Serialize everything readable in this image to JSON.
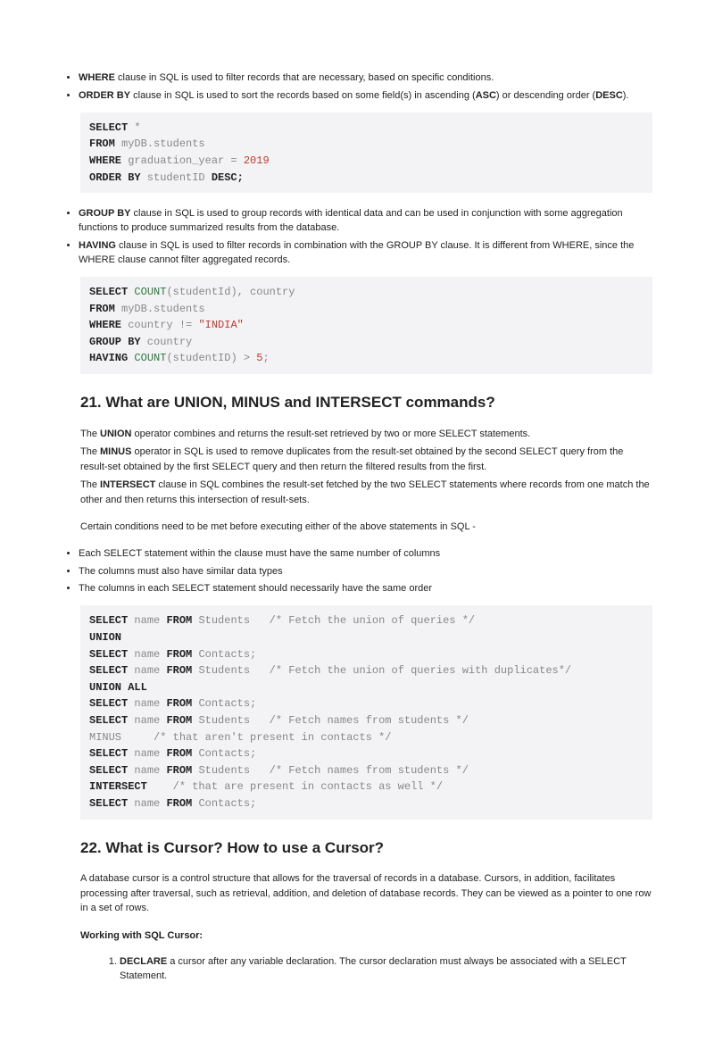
{
  "bullets1": {
    "where_kw": "WHERE",
    "where_txt": " clause in SQL is used to filter records that are necessary, based on specific conditions.",
    "orderby_kw": "ORDER BY",
    "orderby_txt1": " clause in SQL is used to sort the records based on some field(s) in ascending (",
    "orderby_asc": "ASC",
    "orderby_txt2": ") or descending order (",
    "orderby_desc": "DESC",
    "orderby_txt3": ")."
  },
  "code1": {
    "select": "SELECT",
    "star": " *",
    "from": "FROM",
    "tbl": " myDB.students",
    "where": "WHERE",
    "gy": " graduation_year = ",
    "yr": "2019",
    "orderby": "ORDER BY",
    "sid": " studentID ",
    "desc": "DESC;"
  },
  "bullets2": {
    "groupby_kw": "GROUP BY",
    "groupby_txt": " clause in SQL is used to group records with identical data and can be used in conjunction with some aggregation functions to produce summarized results from the database.",
    "having_kw": "HAVING",
    "having_txt": " clause in SQL is used to filter records in combination with the GROUP BY clause. It is different from WHERE, since the WHERE clause cannot filter aggregated records."
  },
  "code2": {
    "select": "SELECT",
    "count1": " COUNT",
    "args1": "(studentId), country",
    "from": "FROM",
    "tbl": " myDB.students",
    "where": "WHERE",
    "cne": " country != ",
    "india": "\"INDIA\"",
    "groupby": "GROUP BY",
    "country": " country",
    "having": "HAVING",
    "count2": " COUNT",
    "args2": "(studentID) > ",
    "five": "5",
    "semi": ";"
  },
  "q21": {
    "title": "21. What are UNION, MINUS and INTERSECT commands?",
    "p1a": "The ",
    "p1b": "UNION",
    "p1c": " operator combines and returns the result-set retrieved by two or more SELECT statements.",
    "p2a": "The ",
    "p2b": "MINUS",
    "p2c": " operator in SQL is used to remove duplicates from the result-set obtained by the second SELECT query from the result-set obtained by the first SELECT query and then return the filtered results from the first.",
    "p3a": "The ",
    "p3b": "INTERSECT",
    "p3c": " clause in SQL combines the result-set fetched by the two SELECT statements where records from one match the other and then returns this intersection of result-sets.",
    "p4": "Certain conditions need to be met before executing either of the above statements in SQL -"
  },
  "bullets3": {
    "b1": "Each SELECT statement within the clause must have the same number of columns",
    "b2": "The columns must also have similar data types",
    "b3": "The columns in each SELECT statement should necessarily have the same order"
  },
  "code3": {
    "select": "SELECT",
    "name": " name ",
    "from": "FROM",
    "students": " Students   ",
    "contacts_semi": " Contacts;",
    "cmt1": "/* Fetch the union of queries */",
    "union": "UNION",
    "cmt2": "/* Fetch the union of queries with duplicates*/",
    "unionall": "UNION ALL",
    "cmt3": "/* Fetch names from students */",
    "minus": "MINUS",
    "cmt4": "/* that aren't present in contacts */",
    "intersect": "INTERSECT",
    "cmt5": "/* that are present in contacts as well */",
    "pad_minus": "     ",
    "pad_intersect": "    "
  },
  "q22": {
    "title": "22. What is Cursor? How to use a Cursor?",
    "p1": "A database cursor is a control structure that allows for the traversal of records in a database. Cursors, in addition, facilitates processing after traversal, such as retrieval, addition, and deletion of database records. They can be viewed as a pointer to one row in a set of rows.",
    "p2": "Working with SQL Cursor:",
    "declare_kw": "DECLARE",
    "declare_txt": " a cursor after any variable declaration. The cursor declaration must always be associated with a SELECT Statement."
  }
}
